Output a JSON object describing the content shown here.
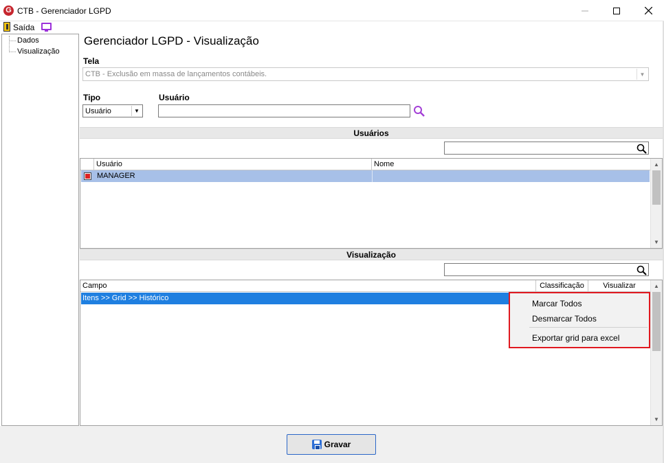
{
  "window": {
    "logo_letter": "G",
    "title": "CTB - Gerenciador LGPD"
  },
  "menu": {
    "exit_label": "Saída"
  },
  "tree": {
    "items": [
      "Dados",
      "Visualização"
    ]
  },
  "main": {
    "title": "Gerenciador LGPD - Visualização",
    "tela_label": "Tela",
    "tela_value": "CTB - Exclusão em massa de lançamentos contábeis.",
    "tipo_label": "Tipo",
    "tipo_value": "Usuário",
    "usuario_label": "Usuário",
    "usuario_value": ""
  },
  "users_section": {
    "title": "Usuários",
    "columns": [
      "Usuário",
      "Nome"
    ],
    "rows": [
      {
        "usuario": "MANAGER",
        "nome": "",
        "checked": true
      }
    ]
  },
  "visual_section": {
    "title": "Visualização",
    "columns": [
      "Campo",
      "Classificação",
      "Visualizar"
    ],
    "rows": [
      {
        "campo": "Itens >> Grid >> Histórico"
      }
    ]
  },
  "context_menu": {
    "items": [
      "Marcar Todos",
      "Desmarcar Todos",
      "Exportar grid para excel"
    ]
  },
  "footer": {
    "save_label": "Gravar"
  },
  "colors": {
    "accent_border": "#e0181f",
    "selected_row": "#1f7fe0",
    "checked_row": "#a7c0e8"
  }
}
